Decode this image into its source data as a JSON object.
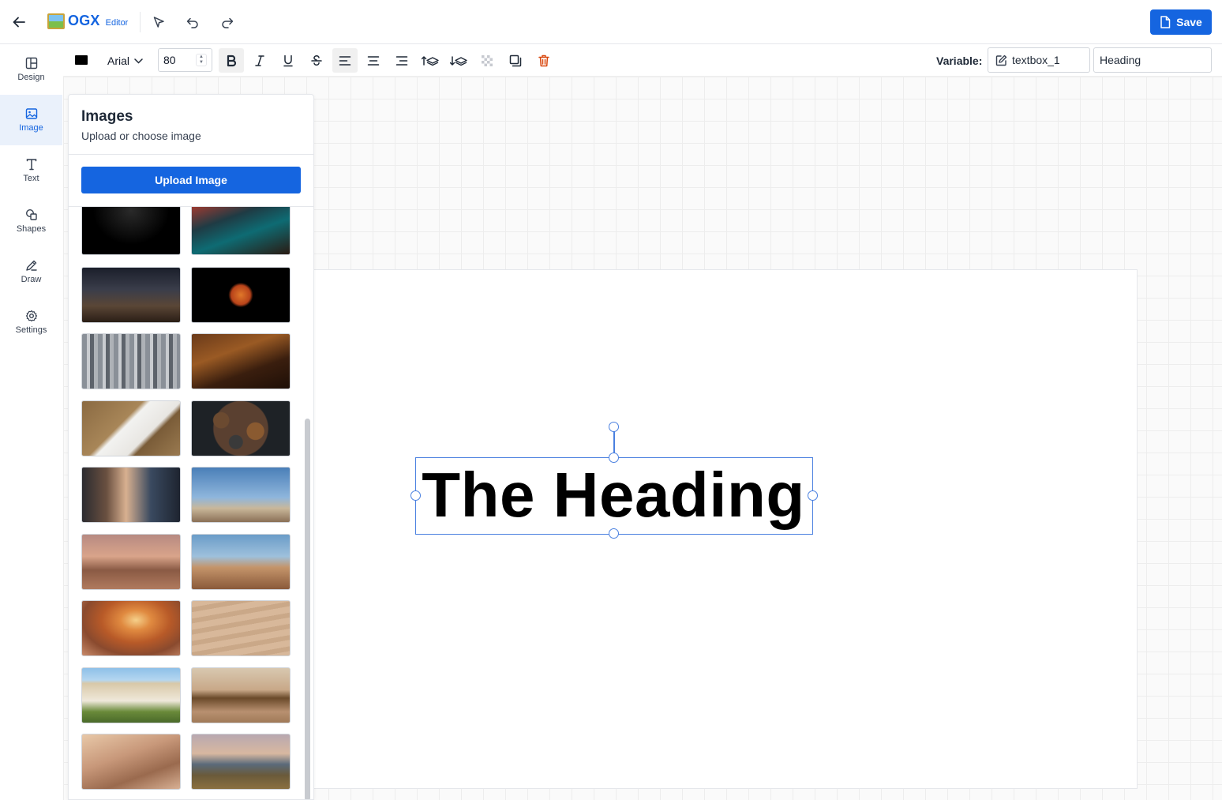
{
  "app": {
    "logo_text": "OGX",
    "logo_sub": "Editor",
    "save_label": "Save"
  },
  "nav": {
    "items": [
      {
        "label": "Design",
        "icon": "layout-icon"
      },
      {
        "label": "Image",
        "icon": "image-icon",
        "active": true
      },
      {
        "label": "Text",
        "icon": "text-icon"
      },
      {
        "label": "Shapes",
        "icon": "shapes-icon"
      },
      {
        "label": "Draw",
        "icon": "pencil-icon"
      },
      {
        "label": "Settings",
        "icon": "gear-icon"
      }
    ]
  },
  "format": {
    "text_color": "#000000",
    "font_family": "Arial",
    "font_size": "80",
    "variable_label": "Variable:",
    "variable_name": "textbox_1",
    "variable_value": "Heading"
  },
  "panel": {
    "title": "Images",
    "subtitle": "Upload or choose image",
    "upload_label": "Upload Image"
  },
  "canvas": {
    "heading_text": "The Heading"
  },
  "colors": {
    "accent": "#1565e0",
    "selection": "#4a80e0",
    "delete": "#d9480f"
  }
}
